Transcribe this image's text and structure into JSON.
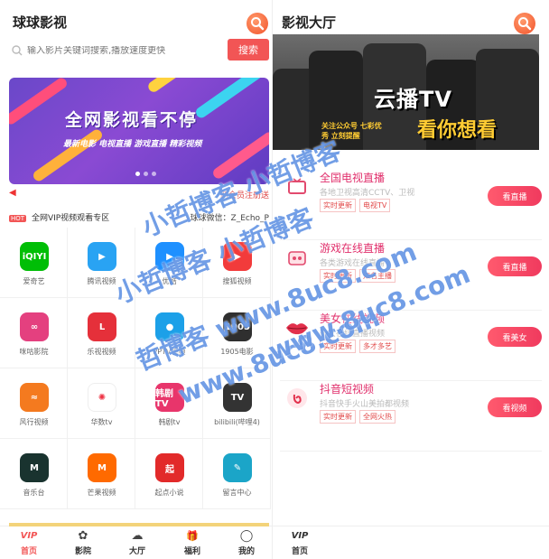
{
  "left": {
    "title": "球球影视",
    "search_placeholder": "输入影片关键词搜索,播放速度更快",
    "search_button": "搜索",
    "banner": {
      "headline": "全网影视看不停",
      "subline": "最新电影  电视直播  游戏直播  精彩视频"
    },
    "notice": "新会员注册送",
    "vip": {
      "hot_badge": "HOT",
      "label": "全网VIP视频观看专区",
      "right_text": "球球微信：Z_Echo_P"
    },
    "apps": [
      {
        "label": "爱奇艺",
        "icon_text": "iQIYI",
        "color": "#00be06"
      },
      {
        "label": "腾讯视频",
        "icon_text": "▶",
        "color": "#29a3f3"
      },
      {
        "label": "优酷",
        "icon_text": "▶",
        "color": "#1e90ff"
      },
      {
        "label": "搜狐视频",
        "icon_text": "▶",
        "color": "#f23b3b"
      },
      {
        "label": "咪咕影院",
        "icon_text": "∞",
        "color": "#e4407f"
      },
      {
        "label": "乐视视频",
        "icon_text": "L",
        "color": "#e5303a"
      },
      {
        "label": "PPTV视频",
        "icon_text": "●",
        "color": "#1ca0e8"
      },
      {
        "label": "1905电影",
        "icon_text": "1905",
        "color": "#2f2f2f"
      },
      {
        "label": "风行视频",
        "icon_text": "≈",
        "color": "#f47a1f"
      },
      {
        "label": "华数tv",
        "icon_text": "✺",
        "color": "#ffffff"
      },
      {
        "label": "韩剧tv",
        "icon_text": "韩剧TV",
        "color": "#e8356b"
      },
      {
        "label": "bilibili(哔哩4)",
        "icon_text": "TV",
        "color": "#333333"
      },
      {
        "label": "音乐台",
        "icon_text": "M",
        "color": "#19332f"
      },
      {
        "label": "芒果视频",
        "icon_text": "M",
        "color": "#ff6a00"
      },
      {
        "label": "起点小说",
        "icon_text": "起",
        "color": "#e22a2a"
      },
      {
        "label": "留言中心",
        "icon_text": "✎",
        "color": "#1ba5c8"
      }
    ],
    "tabs": [
      {
        "label": "首页",
        "icon": "VIP"
      },
      {
        "label": "影院",
        "icon": "✿"
      },
      {
        "label": "大厅",
        "icon": "☁"
      },
      {
        "label": "福利",
        "icon": "🎁"
      },
      {
        "label": "我的",
        "icon": "◯"
      }
    ]
  },
  "right": {
    "title": "影视大厅",
    "banner": {
      "logo": "云播TV",
      "logo2": "看你想看",
      "tagline": "关注公众号 七彩优秀 立刻提醒"
    },
    "categories": [
      {
        "title": "全国电视直播",
        "desc": "各地卫视高清CCTV、卫视",
        "tags": [
          "实时更新",
          "电视TV"
        ],
        "button": "看直播",
        "icon": "tv-icon"
      },
      {
        "title": "游戏在线直播",
        "desc": "各类游戏在线直播",
        "tags": [
          "实时更新",
          "知名主播"
        ],
        "button": "看直播",
        "icon": "game-icon"
      },
      {
        "title": "美女在线视频",
        "desc": "美女在线直播视频",
        "tags": [
          "实时更新",
          "多才多艺"
        ],
        "button": "看美女",
        "icon": "lips-icon"
      },
      {
        "title": "抖音短视频",
        "desc": "抖音快手火山美拍都视频",
        "tags": [
          "实时更新",
          "全网火热"
        ],
        "button": "看视频",
        "icon": "douyin-icon"
      }
    ],
    "tab": {
      "label": "首页",
      "icon": "VIP"
    }
  },
  "watermarks": [
    "小哲博客 小哲博客",
    "小哲博客 小哲博客",
    "哲博客 www.8uc8.com",
    "www.8uc8.com",
    "www.8uc8.com"
  ]
}
